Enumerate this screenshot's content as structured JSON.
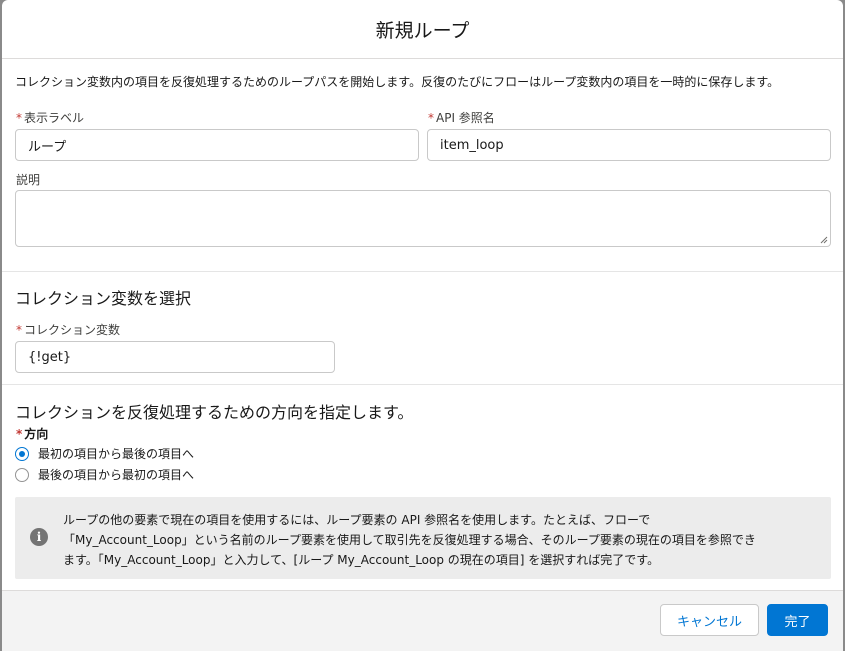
{
  "modal": {
    "title": "新規ループ",
    "description": "コレクション変数内の項目を反復処理するためのループパスを開始します。反復のたびにフローはループ変数内の項目を一時的に保存します。"
  },
  "fields": {
    "required_mark": "*",
    "label_field": {
      "label": "表示ラベル",
      "value": "ループ"
    },
    "api_name_field": {
      "label": "API 参照名",
      "value": "item_loop"
    },
    "description_field": {
      "label": "説明",
      "value": ""
    }
  },
  "collection_section": {
    "title": "コレクション変数を選択",
    "variable_label": "コレクション変数",
    "variable_value": "{!get}"
  },
  "direction_section": {
    "title": "コレクションを反復処理するための方向を指定します。",
    "label": "方向",
    "options": [
      {
        "label": "最初の項目から最後の項目へ",
        "selected": true
      },
      {
        "label": "最後の項目から最初の項目へ",
        "selected": false
      }
    ]
  },
  "info": {
    "icon": "info-icon",
    "line1": "ループの他の要素で現在の項目を使用するには、ループ要素の API 参照名を使用します。たとえば、フローで",
    "line2": "「My_Account_Loop」という名前のループ要素を使用して取引先を反復処理する場合、そのループ要素の現在の項目を参照でき",
    "line3": "ます。「My_Account_Loop」と入力して、[ループ My_Account_Loop の現在の項目] を選択すれば完了です。"
  },
  "footer": {
    "cancel_label": "キャンセル",
    "done_label": "完了"
  },
  "colors": {
    "brand": "#0176d3",
    "required": "#c23934",
    "info_bg": "#ececec"
  }
}
